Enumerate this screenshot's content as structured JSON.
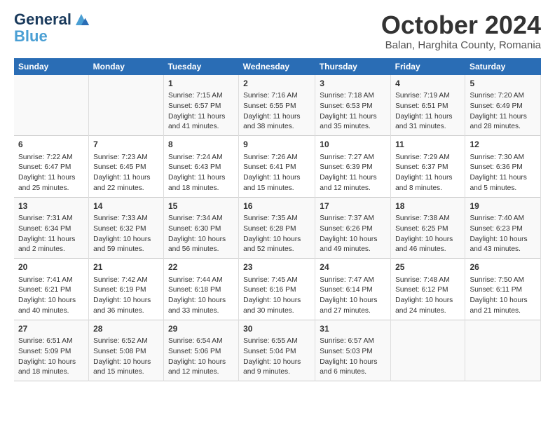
{
  "logo": {
    "line1": "General",
    "line2": "Blue"
  },
  "title": "October 2024",
  "location": "Balan, Harghita County, Romania",
  "days_of_week": [
    "Sunday",
    "Monday",
    "Tuesday",
    "Wednesday",
    "Thursday",
    "Friday",
    "Saturday"
  ],
  "weeks": [
    [
      {
        "day": "",
        "content": ""
      },
      {
        "day": "",
        "content": ""
      },
      {
        "day": "1",
        "content": "Sunrise: 7:15 AM\nSunset: 6:57 PM\nDaylight: 11 hours and 41 minutes."
      },
      {
        "day": "2",
        "content": "Sunrise: 7:16 AM\nSunset: 6:55 PM\nDaylight: 11 hours and 38 minutes."
      },
      {
        "day": "3",
        "content": "Sunrise: 7:18 AM\nSunset: 6:53 PM\nDaylight: 11 hours and 35 minutes."
      },
      {
        "day": "4",
        "content": "Sunrise: 7:19 AM\nSunset: 6:51 PM\nDaylight: 11 hours and 31 minutes."
      },
      {
        "day": "5",
        "content": "Sunrise: 7:20 AM\nSunset: 6:49 PM\nDaylight: 11 hours and 28 minutes."
      }
    ],
    [
      {
        "day": "6",
        "content": "Sunrise: 7:22 AM\nSunset: 6:47 PM\nDaylight: 11 hours and 25 minutes."
      },
      {
        "day": "7",
        "content": "Sunrise: 7:23 AM\nSunset: 6:45 PM\nDaylight: 11 hours and 22 minutes."
      },
      {
        "day": "8",
        "content": "Sunrise: 7:24 AM\nSunset: 6:43 PM\nDaylight: 11 hours and 18 minutes."
      },
      {
        "day": "9",
        "content": "Sunrise: 7:26 AM\nSunset: 6:41 PM\nDaylight: 11 hours and 15 minutes."
      },
      {
        "day": "10",
        "content": "Sunrise: 7:27 AM\nSunset: 6:39 PM\nDaylight: 11 hours and 12 minutes."
      },
      {
        "day": "11",
        "content": "Sunrise: 7:29 AM\nSunset: 6:37 PM\nDaylight: 11 hours and 8 minutes."
      },
      {
        "day": "12",
        "content": "Sunrise: 7:30 AM\nSunset: 6:36 PM\nDaylight: 11 hours and 5 minutes."
      }
    ],
    [
      {
        "day": "13",
        "content": "Sunrise: 7:31 AM\nSunset: 6:34 PM\nDaylight: 11 hours and 2 minutes."
      },
      {
        "day": "14",
        "content": "Sunrise: 7:33 AM\nSunset: 6:32 PM\nDaylight: 10 hours and 59 minutes."
      },
      {
        "day": "15",
        "content": "Sunrise: 7:34 AM\nSunset: 6:30 PM\nDaylight: 10 hours and 56 minutes."
      },
      {
        "day": "16",
        "content": "Sunrise: 7:35 AM\nSunset: 6:28 PM\nDaylight: 10 hours and 52 minutes."
      },
      {
        "day": "17",
        "content": "Sunrise: 7:37 AM\nSunset: 6:26 PM\nDaylight: 10 hours and 49 minutes."
      },
      {
        "day": "18",
        "content": "Sunrise: 7:38 AM\nSunset: 6:25 PM\nDaylight: 10 hours and 46 minutes."
      },
      {
        "day": "19",
        "content": "Sunrise: 7:40 AM\nSunset: 6:23 PM\nDaylight: 10 hours and 43 minutes."
      }
    ],
    [
      {
        "day": "20",
        "content": "Sunrise: 7:41 AM\nSunset: 6:21 PM\nDaylight: 10 hours and 40 minutes."
      },
      {
        "day": "21",
        "content": "Sunrise: 7:42 AM\nSunset: 6:19 PM\nDaylight: 10 hours and 36 minutes."
      },
      {
        "day": "22",
        "content": "Sunrise: 7:44 AM\nSunset: 6:18 PM\nDaylight: 10 hours and 33 minutes."
      },
      {
        "day": "23",
        "content": "Sunrise: 7:45 AM\nSunset: 6:16 PM\nDaylight: 10 hours and 30 minutes."
      },
      {
        "day": "24",
        "content": "Sunrise: 7:47 AM\nSunset: 6:14 PM\nDaylight: 10 hours and 27 minutes."
      },
      {
        "day": "25",
        "content": "Sunrise: 7:48 AM\nSunset: 6:12 PM\nDaylight: 10 hours and 24 minutes."
      },
      {
        "day": "26",
        "content": "Sunrise: 7:50 AM\nSunset: 6:11 PM\nDaylight: 10 hours and 21 minutes."
      }
    ],
    [
      {
        "day": "27",
        "content": "Sunrise: 6:51 AM\nSunset: 5:09 PM\nDaylight: 10 hours and 18 minutes."
      },
      {
        "day": "28",
        "content": "Sunrise: 6:52 AM\nSunset: 5:08 PM\nDaylight: 10 hours and 15 minutes."
      },
      {
        "day": "29",
        "content": "Sunrise: 6:54 AM\nSunset: 5:06 PM\nDaylight: 10 hours and 12 minutes."
      },
      {
        "day": "30",
        "content": "Sunrise: 6:55 AM\nSunset: 5:04 PM\nDaylight: 10 hours and 9 minutes."
      },
      {
        "day": "31",
        "content": "Sunrise: 6:57 AM\nSunset: 5:03 PM\nDaylight: 10 hours and 6 minutes."
      },
      {
        "day": "",
        "content": ""
      },
      {
        "day": "",
        "content": ""
      }
    ]
  ]
}
